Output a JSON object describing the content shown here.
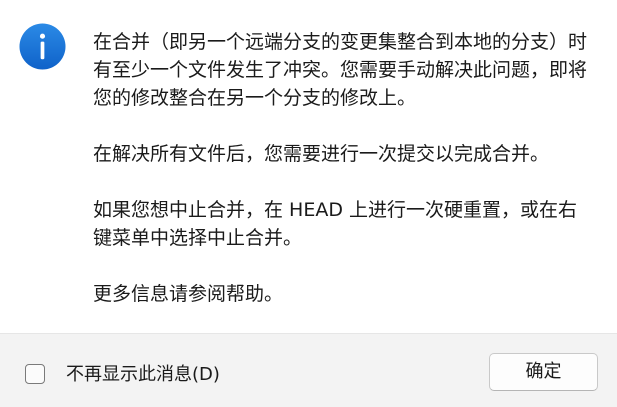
{
  "icon": {
    "name": "info-icon",
    "color": "#1a73d9"
  },
  "message": {
    "p1": "在合并（即另一个远端分支的变更集整合到本地的分支）时有至少一个文件发生了冲突。您需要手动解决此问题，即将您的修改整合在另一个分支的修改上。",
    "p2": "在解决所有文件后，您需要进行一次提交以完成合并。",
    "p3": "如果您想中止合并，在 HEAD 上进行一次硬重置，或在右键菜单中选择中止合并。",
    "p4": "更多信息请参阅帮助。"
  },
  "footer": {
    "checkbox_label": "不再显示此消息(D)",
    "checkbox_checked": false,
    "ok_label": "确定"
  }
}
